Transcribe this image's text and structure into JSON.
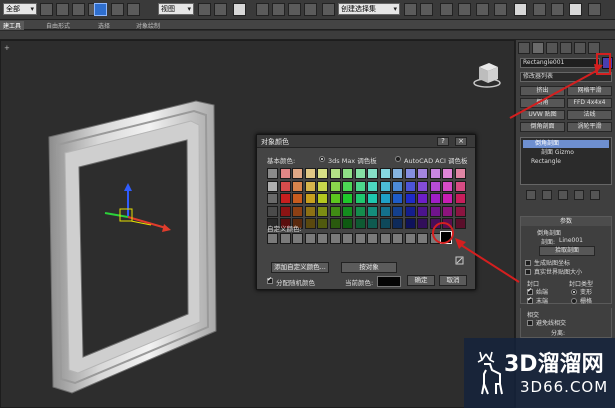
{
  "toolbar": {
    "selection_filter": "全部",
    "reference_coord": "视图",
    "named_selection": "创建选择集",
    "accent_color": "#2f6fcf"
  },
  "ribbon": {
    "tabs": [
      "建工具",
      "自由形式",
      "选择",
      "对象绘制"
    ]
  },
  "viewport": {
    "label": "+"
  },
  "command_panel": {
    "object_name": "Rectangle001",
    "object_color": "#4a3fb0",
    "modifier_list": "修改器列表",
    "modifier_buttons": [
      "挤出",
      "网格平滑",
      "倒角",
      "FFD 4x4x4",
      "UVW 贴图",
      "法线",
      "倒角剖面",
      "涡轮平滑"
    ],
    "stack": [
      "倒角剖面",
      "剖面 Gizmo",
      "Rectangle"
    ],
    "params_title": "参数",
    "bevel_profile_label": "倒角剖面",
    "profile_label": "剖面:",
    "profile_value": "Line001",
    "pick_profile_button": "拾取剖面",
    "gen_mapping": "生成贴图坐标",
    "real_world": "真实世界贴图大小",
    "cap_title": "封口",
    "cap_start": "始端",
    "cap_end": "末端",
    "cap_type_title": "封口类型",
    "cap_morph": "变形",
    "cap_grid": "栅格",
    "intersect_title": "相交",
    "avoid_self_intersect": "避免线相交",
    "sep_label": "分离:"
  },
  "dialog": {
    "title": "对象颜色",
    "help_button": "?",
    "close_button": "×",
    "basic_colors_label": "基本颜色:",
    "palette_3dsmax": "3ds Max 调色板",
    "palette_autocad": "AutoCAD ACI 调色板",
    "custom_colors_label": "自定义颜色:",
    "add_custom_button": "添加自定义颜色...",
    "by_object_button": "按对象",
    "random_colors_label": "分配随机颜色",
    "current_color_label": "当前颜色:",
    "ok_button": "确定",
    "cancel_button": "取消",
    "current_color": "#050505",
    "swatch_rows": [
      [
        "#8a8a8a",
        "#e08686",
        "#e0a886",
        "#e0c886",
        "#d7e086",
        "#b4e086",
        "#8fe086",
        "#86e0a4",
        "#86e0c8",
        "#86d7e0",
        "#86b4e0",
        "#868fe0",
        "#a486e0",
        "#c886e0",
        "#e086d7",
        "#e086a4"
      ],
      [
        "#b0b0b0",
        "#d64c4c",
        "#d6844c",
        "#d6b54c",
        "#c8d64c",
        "#8ad64c",
        "#4cd654",
        "#4cd68a",
        "#4cd6c0",
        "#4cbcd6",
        "#4c8ad6",
        "#4c54d6",
        "#844cd6",
        "#b54cd6",
        "#d64cc8",
        "#d64c84"
      ],
      [
        "#6a6a6a",
        "#c81e1e",
        "#c85c1e",
        "#c8a01e",
        "#b4c81e",
        "#5cc81e",
        "#1ec82a",
        "#1ec86e",
        "#1ec8b0",
        "#1ea0c8",
        "#1e5cc8",
        "#1e2ac8",
        "#6e1ec8",
        "#a01ec8",
        "#c81eb4",
        "#c81e5c"
      ],
      [
        "#4a4a4a",
        "#8c1414",
        "#8c4014",
        "#8c7014",
        "#7c8c14",
        "#408c14",
        "#148c1e",
        "#148c4c",
        "#148c7c",
        "#14708c",
        "#14408c",
        "#141e8c",
        "#4c148c",
        "#70148c",
        "#8c147c",
        "#8c1440"
      ],
      [
        "#2a2a2a",
        "#5a0e0e",
        "#5a2a0e",
        "#5a480e",
        "#505a0e",
        "#2a5a0e",
        "#0e5a12",
        "#0e5a32",
        "#0e5a50",
        "#0e485a",
        "#0e2a5a",
        "#0e125a",
        "#320e5a",
        "#480e5a",
        "#5a0e50",
        "#5a0e2a"
      ]
    ],
    "custom_swatches": 14
  },
  "annotations": {
    "highlight_color": "#d41f1f"
  },
  "watermark": {
    "main": "3D溜溜网",
    "sub": "3D66.COM"
  }
}
